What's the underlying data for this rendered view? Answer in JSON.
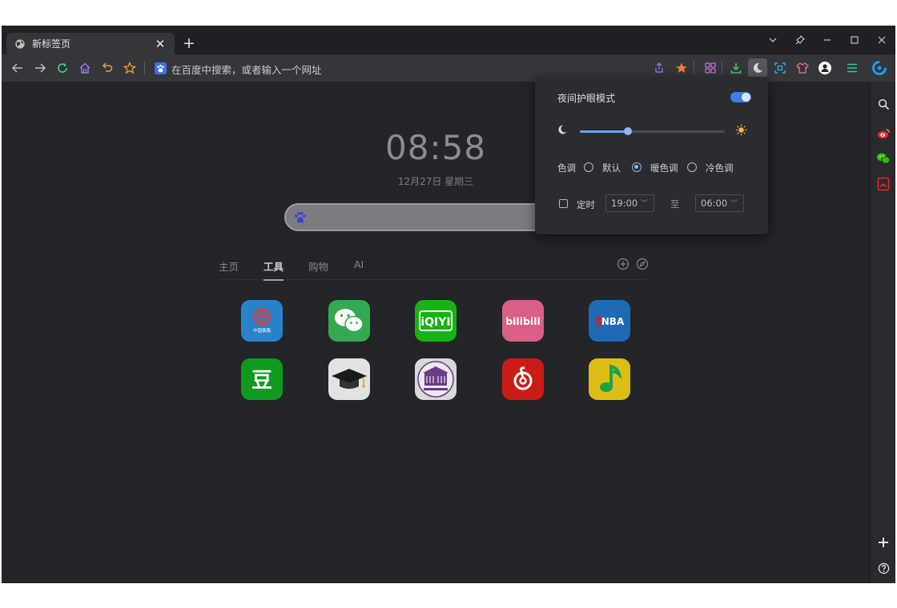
{
  "tab": {
    "title": "新标签页",
    "close": "✕"
  },
  "new_tab": "+",
  "address": {
    "placeholder": "在百度中搜索，或者输入一个网址"
  },
  "clock": {
    "time": "08:58",
    "date": "12月27日 星期三"
  },
  "nav": {
    "tabs": [
      "主页",
      "工具",
      "购物",
      "AI"
    ],
    "active_index": 1
  },
  "apps": [
    {
      "name": "railway-12306",
      "color": "#1d73b6",
      "sub": "中国铁路"
    },
    {
      "name": "wechat",
      "color": "#34a853"
    },
    {
      "name": "iqiyi",
      "color": "#17b313",
      "text": "iQIYI"
    },
    {
      "name": "bilibili",
      "color": "#d85f86",
      "text": "bilibili"
    },
    {
      "name": "nba",
      "color": "#1e6ab5",
      "text": "NBA"
    },
    {
      "name": "douban",
      "color": "#0f9a1f",
      "text": "豆"
    },
    {
      "name": "scholar",
      "color": "#e2e2e2"
    },
    {
      "name": "university",
      "color": "#d9d9d9"
    },
    {
      "name": "netease-music",
      "color": "#cc1c18"
    },
    {
      "name": "qq-music",
      "color": "#dcbd16"
    }
  ],
  "night_panel": {
    "title": "夜间护眼模式",
    "enabled": true,
    "brightness_fraction": 0.33,
    "tone_label": "色调",
    "tones": [
      "默认",
      "暖色调",
      "冷色调"
    ],
    "tone_selected": 1,
    "timer_label": "定时",
    "timer_checked": false,
    "start_time": "19:00",
    "to_label": "至",
    "end_time": "06:00"
  },
  "colors": {
    "accent": "#3f7ee6",
    "panel_bg": "#2b2c30",
    "page_bg": "#232529"
  }
}
